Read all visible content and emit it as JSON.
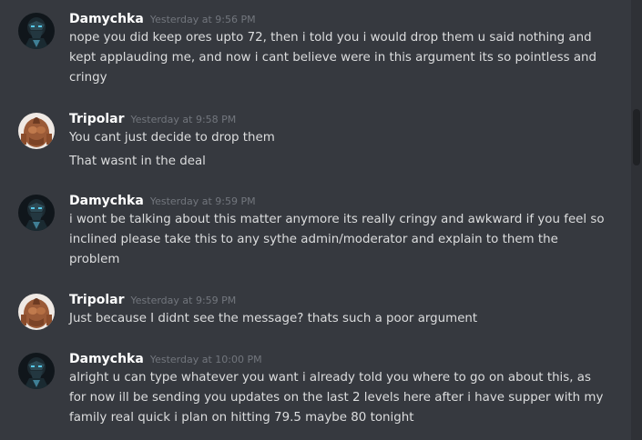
{
  "messages": [
    {
      "author": "Damychka",
      "avatar": "damychka-avatar",
      "timestamp": "Yesterday at 9:56 PM",
      "lines": [
        "nope you did keep ores upto 72, then i told you i would drop them u said nothing and kept applauding me, and now i cant believe were in this argument its so pointless and cringy"
      ]
    },
    {
      "author": "Tripolar",
      "avatar": "tripolar-avatar",
      "timestamp": "Yesterday at 9:58 PM",
      "lines": [
        "You cant just decide to drop them",
        "That wasnt in the deal"
      ]
    },
    {
      "author": "Damychka",
      "avatar": "damychka-avatar",
      "timestamp": "Yesterday at 9:59 PM",
      "lines": [
        "i wont be talking about this matter anymore its really cringy and awkward if you feel so inclined please take this to any sythe admin/moderator and explain to them the problem"
      ]
    },
    {
      "author": "Tripolar",
      "avatar": "tripolar-avatar",
      "timestamp": "Yesterday at 9:59 PM",
      "lines": [
        "Just because I didnt see the message? thats such a poor argument"
      ]
    },
    {
      "author": "Damychka",
      "avatar": "damychka-avatar",
      "timestamp": "Yesterday at 10:00 PM",
      "lines": [
        "alright u can type whatever you want i already told you where to go on about this, as for now ill be sending you updates on the last 2 levels here after i have supper with my family real quick i plan on hitting 79.5 maybe 80 tonight"
      ]
    }
  ],
  "colors": {
    "background": "#36393f",
    "username": "#ffffff",
    "timestamp": "#72767d",
    "message_text": "#dcddde"
  }
}
